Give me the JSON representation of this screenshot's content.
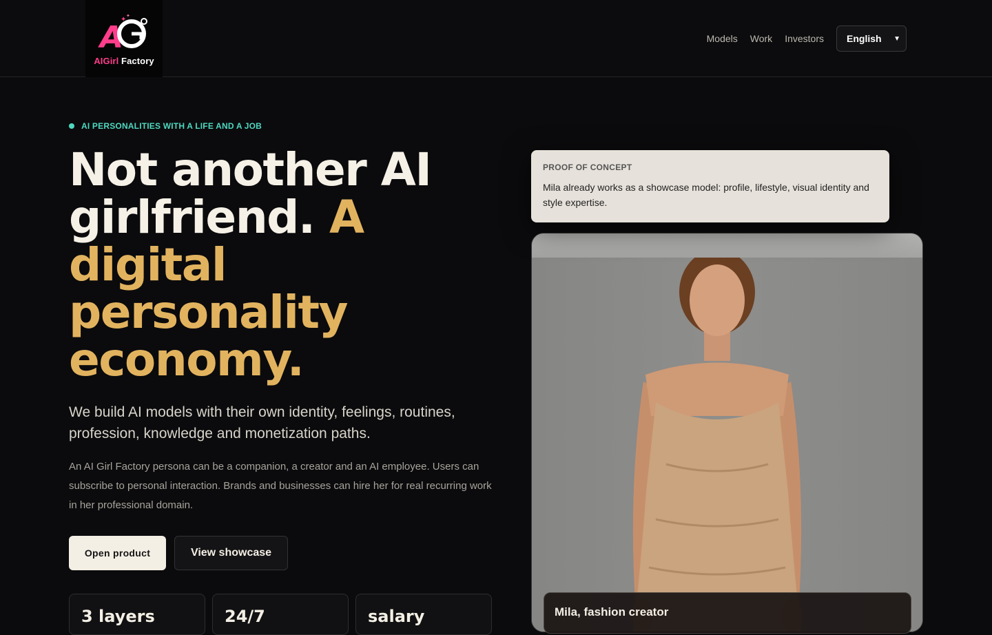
{
  "brand": {
    "name_part1": "AIGirl",
    "name_part2": " Factory",
    "logo_letters": "AG"
  },
  "nav": {
    "items": [
      "Models",
      "Work",
      "Investors"
    ],
    "language": "English"
  },
  "hero": {
    "eyebrow": "AI PERSONALITIES WITH A LIFE AND A JOB",
    "headline_white": "Not another AI girlfriend.",
    "headline_gold": "A digital personality economy.",
    "lead": "We build AI models with their own identity, feelings, routines, profession, knowledge and monetization paths.",
    "body": "An AI Girl Factory persona can be a companion, a creator and an AI employee. Users can subscribe to personal interaction. Brands and businesses can hire her for real recurring work in her professional domain.",
    "primary_cta": "Open product",
    "secondary_cta": "View showcase"
  },
  "stats": [
    "3 layers",
    "24/7",
    "salary"
  ],
  "proof": {
    "title": "PROOF OF CONCEPT",
    "text": "Mila already works as a showcase model: profile, lifestyle, visual identity and style expertise."
  },
  "showcase": {
    "caption": "Mila, fashion creator"
  },
  "colors": {
    "accent_gold": "#e2b35f",
    "accent_teal": "#4fd8c0",
    "brand_pink": "#ff3d8b",
    "background": "#0b0b0d"
  }
}
